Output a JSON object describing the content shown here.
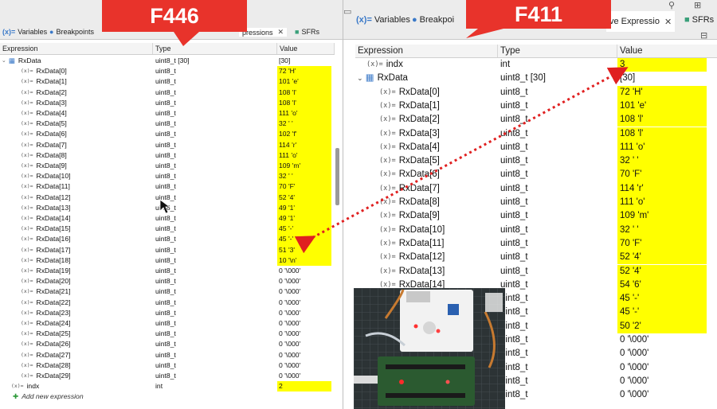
{
  "labels": {
    "left_board": "F446",
    "right_board": "F411"
  },
  "left": {
    "tabs": [
      {
        "icon": "(x)=",
        "label": "Variables"
      },
      {
        "icon": "●",
        "label": "Breakpoints"
      },
      {
        "label": "pressions"
      },
      {
        "icon": "■",
        "label": "SFRs"
      }
    ],
    "columns": [
      "Expression",
      "Type",
      "Value"
    ],
    "rxdata": {
      "name": "RxData",
      "type": "uint8_t [30]",
      "value": "[30]"
    },
    "elements": [
      {
        "name": "RxData[0]",
        "type": "uint8_t",
        "value": "72 'H'",
        "hl": true
      },
      {
        "name": "RxData[1]",
        "type": "uint8_t",
        "value": "101 'e'",
        "hl": true
      },
      {
        "name": "RxData[2]",
        "type": "uint8_t",
        "value": "108 'l'",
        "hl": true
      },
      {
        "name": "RxData[3]",
        "type": "uint8_t",
        "value": "108 'l'",
        "hl": true
      },
      {
        "name": "RxData[4]",
        "type": "uint8_t",
        "value": "111 'o'",
        "hl": true
      },
      {
        "name": "RxData[5]",
        "type": "uint8_t",
        "value": "32 ' '",
        "hl": true
      },
      {
        "name": "RxData[6]",
        "type": "uint8_t",
        "value": "102 'f'",
        "hl": true
      },
      {
        "name": "RxData[7]",
        "type": "uint8_t",
        "value": "114 'r'",
        "hl": true
      },
      {
        "name": "RxData[8]",
        "type": "uint8_t",
        "value": "111 'o'",
        "hl": true
      },
      {
        "name": "RxData[9]",
        "type": "uint8_t",
        "value": "109 'm'",
        "hl": true
      },
      {
        "name": "RxData[10]",
        "type": "uint8_t",
        "value": "32 ' '",
        "hl": true
      },
      {
        "name": "RxData[11]",
        "type": "uint8_t",
        "value": "70 'F'",
        "hl": true
      },
      {
        "name": "RxData[12]",
        "type": "uint8_t",
        "value": "52 '4'",
        "hl": true
      },
      {
        "name": "RxData[13]",
        "type": "uint8_t",
        "value": "49 '1'",
        "hl": true
      },
      {
        "name": "RxData[14]",
        "type": "uint8_t",
        "value": "49 '1'",
        "hl": true
      },
      {
        "name": "RxData[15]",
        "type": "uint8_t",
        "value": "45 '-'",
        "hl": true
      },
      {
        "name": "RxData[16]",
        "type": "uint8_t",
        "value": "45 '-'",
        "hl": true
      },
      {
        "name": "RxData[17]",
        "type": "uint8_t",
        "value": "51 '3'",
        "hl": true
      },
      {
        "name": "RxData[18]",
        "type": "uint8_t",
        "value": "10 '\\n'",
        "hl": true
      },
      {
        "name": "RxData[19]",
        "type": "uint8_t",
        "value": "0 '\\000'",
        "hl": false
      },
      {
        "name": "RxData[20]",
        "type": "uint8_t",
        "value": "0 '\\000'",
        "hl": false
      },
      {
        "name": "RxData[21]",
        "type": "uint8_t",
        "value": "0 '\\000'",
        "hl": false
      },
      {
        "name": "RxData[22]",
        "type": "uint8_t",
        "value": "0 '\\000'",
        "hl": false
      },
      {
        "name": "RxData[23]",
        "type": "uint8_t",
        "value": "0 '\\000'",
        "hl": false
      },
      {
        "name": "RxData[24]",
        "type": "uint8_t",
        "value": "0 '\\000'",
        "hl": false
      },
      {
        "name": "RxData[25]",
        "type": "uint8_t",
        "value": "0 '\\000'",
        "hl": false
      },
      {
        "name": "RxData[26]",
        "type": "uint8_t",
        "value": "0 '\\000'",
        "hl": false
      },
      {
        "name": "RxData[27]",
        "type": "uint8_t",
        "value": "0 '\\000'",
        "hl": false
      },
      {
        "name": "RxData[28]",
        "type": "uint8_t",
        "value": "0 '\\000'",
        "hl": false
      },
      {
        "name": "RxData[29]",
        "type": "uint8_t",
        "value": "0 '\\000'",
        "hl": false
      }
    ],
    "indx": {
      "name": "indx",
      "type": "int",
      "value": "2"
    },
    "add_expression": "Add new expression"
  },
  "right": {
    "tabs": [
      {
        "icon": "(x)=",
        "label": "Variables"
      },
      {
        "icon": "●",
        "label": "Breakpoi"
      },
      {
        "label": "ve Expressio"
      },
      {
        "icon": "■",
        "label": "SFRs"
      }
    ],
    "columns": [
      "Expression",
      "Type",
      "Value"
    ],
    "indx": {
      "name": "indx",
      "type": "int",
      "value": "3"
    },
    "rxdata": {
      "name": "RxData",
      "type": "uint8_t [30]",
      "value": "[30]"
    },
    "elements": [
      {
        "name": "RxData[0]",
        "type": "uint8_t",
        "value": "72 'H'",
        "hl": true
      },
      {
        "name": "RxData[1]",
        "type": "uint8_t",
        "value": "101 'e'",
        "hl": true
      },
      {
        "name": "RxData[2]",
        "type": "uint8_t",
        "value": "108 'l'",
        "hl": true
      },
      {
        "name": "RxData[3]",
        "type": "uint8_t",
        "value": "108 'l'",
        "hl": true
      },
      {
        "name": "RxData[4]",
        "type": "uint8_t",
        "value": "111 'o'",
        "hl": true
      },
      {
        "name": "RxData[5]",
        "type": "uint8_t",
        "value": "32 ' '",
        "hl": true
      },
      {
        "name": "RxData[6]",
        "type": "uint8_t",
        "value": "70 'F'",
        "hl": true
      },
      {
        "name": "RxData[7]",
        "type": "uint8_t",
        "value": "114 'r'",
        "hl": true
      },
      {
        "name": "RxData[8]",
        "type": "uint8_t",
        "value": "111 'o'",
        "hl": true
      },
      {
        "name": "RxData[9]",
        "type": "uint8_t",
        "value": "109 'm'",
        "hl": true
      },
      {
        "name": "RxData[10]",
        "type": "uint8_t",
        "value": "32 ' '",
        "hl": true
      },
      {
        "name": "RxData[11]",
        "type": "uint8_t",
        "value": "70 'F'",
        "hl": true
      },
      {
        "name": "RxData[12]",
        "type": "uint8_t",
        "value": "52 '4'",
        "hl": true
      },
      {
        "name": "RxData[13]",
        "type": "uint8_t",
        "value": "52 '4'",
        "hl": true
      },
      {
        "name": "RxData[14]",
        "type": "uint8_t",
        "value": "54 '6'",
        "hl": true
      },
      {
        "name": "",
        "type": "uint8_t",
        "value": "45 '-'",
        "hl": true
      },
      {
        "name": "",
        "type": "uint8_t",
        "value": "45 '-'",
        "hl": true
      },
      {
        "name": "",
        "type": "uint8_t",
        "value": "50 '2'",
        "hl": true
      },
      {
        "name": "",
        "type": "uint8_t",
        "value": "0 '\\000'",
        "hl": false
      },
      {
        "name": "",
        "type": "uint8_t",
        "value": "0 '\\000'",
        "hl": false
      },
      {
        "name": "",
        "type": "uint8_t",
        "value": "0 '\\000'",
        "hl": false
      },
      {
        "name": "",
        "type": "uint8_t",
        "value": "0 '\\000'",
        "hl": false
      },
      {
        "name": "",
        "type": "uint8_t",
        "value": "0 '\\000'",
        "hl": false
      }
    ]
  },
  "colors": {
    "highlight": "#ffff00",
    "banner": "#e8332b",
    "arrow": "#e02020"
  }
}
